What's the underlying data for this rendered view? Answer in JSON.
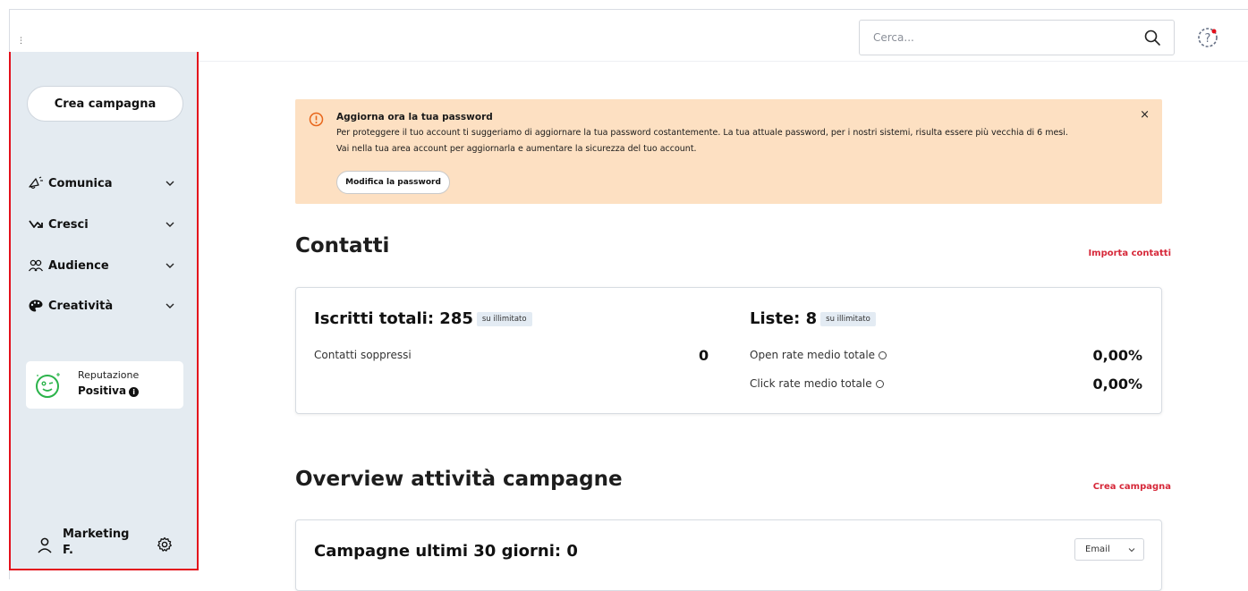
{
  "topbar": {
    "search_placeholder": "Cerca...",
    "icons": {
      "search": "search-icon",
      "help": "help-icon"
    }
  },
  "sidebar": {
    "create_label": "Crea campagna",
    "items": [
      {
        "label": "Comunica",
        "icon": "megaphone-icon"
      },
      {
        "label": "Cresci",
        "icon": "growth-arrow-icon"
      },
      {
        "label": "Audience",
        "icon": "people-icon"
      },
      {
        "label": "Creatività",
        "icon": "palette-icon"
      }
    ],
    "reputation": {
      "label": "Reputazione",
      "value": "Positiva",
      "color": "#2bb34a"
    },
    "user": {
      "name": "Marketing F."
    },
    "accent_border": "#e3101c",
    "background": "#e4ebf1"
  },
  "alert": {
    "title": "Aggiorna ora la tua password",
    "line1": "Per proteggere il tuo account ti suggeriamo di aggiornare la tua password costantemente. La tua attuale password, per i nostri sistemi, risulta essere più vecchia di 6 mesi.",
    "line2": "Vai nella tua area account per aggiornarla e aumentare la sicurezza del tuo account.",
    "button": "Modifica la password",
    "close": "×",
    "background": "#fde0c2"
  },
  "contacts": {
    "heading": "Contatti",
    "link": "Importa contatti",
    "subscribers_title": "Iscritti totali: 285",
    "subscribers_badge": "su illimitato",
    "suppressed_label": "Contatti soppressi",
    "suppressed_value": "0",
    "lists_title": "Liste: 8",
    "lists_badge": "su illimitato",
    "open_rate_label": "Open rate medio totale",
    "open_rate_value": "0,00%",
    "click_rate_label": "Click rate medio totale",
    "click_rate_value": "0,00%"
  },
  "overview": {
    "heading": "Overview attività campagne",
    "link": "Crea campagna",
    "card_title": "Campagne ultimi 30 giorni: 0",
    "select_value": "Email"
  }
}
